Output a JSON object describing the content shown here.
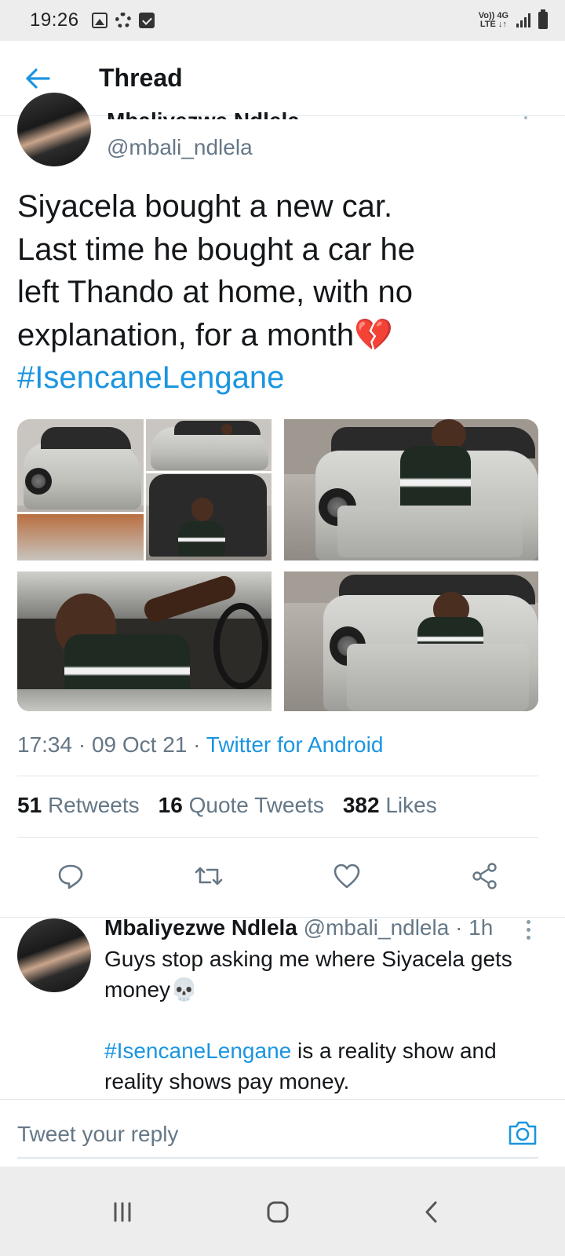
{
  "status_bar": {
    "time": "19:26",
    "left_icons": [
      "image-icon",
      "gear-icon",
      "check-icon"
    ],
    "network_top": "Vo)) 4G",
    "network_bottom": "LTE ↓↑"
  },
  "header": {
    "title": "Thread",
    "back_icon": "arrow-left-icon"
  },
  "main_tweet": {
    "name_cut": "Mbaliyezwe Ndlela",
    "handle": "@mbali_ndlela",
    "text_lines": [
      "Siyacela bought a new car.",
      "Last time he bought a car he",
      "left Thando at home, with no",
      "explanation, for a month💔"
    ],
    "hashtag": "#IsencaneLengane",
    "time": "17:34",
    "date": "09 Oct 21",
    "separator": " · ",
    "source": "Twitter for Android",
    "stats": {
      "retweets_count": "51",
      "retweets_label": "Retweets",
      "quotes_count": "16",
      "quotes_label": "Quote Tweets",
      "likes_count": "382",
      "likes_label": "Likes"
    }
  },
  "reply": {
    "name": "Mbaliyezwe Ndlela",
    "handle": "@mbali_ndlela",
    "time": "· 1h",
    "line1": "Guys stop asking me where Siyacela gets",
    "line2": "money💀",
    "hashtag": "#IsencaneLengane",
    "line3_rest": " is a reality show and",
    "line4": "reality shows pay money."
  },
  "composer": {
    "placeholder": "Tweet your reply"
  },
  "colors": {
    "accent": "#1b95e0",
    "secondary_text": "#657786",
    "divider": "#e1e8ed",
    "system_bar": "#ededed"
  }
}
